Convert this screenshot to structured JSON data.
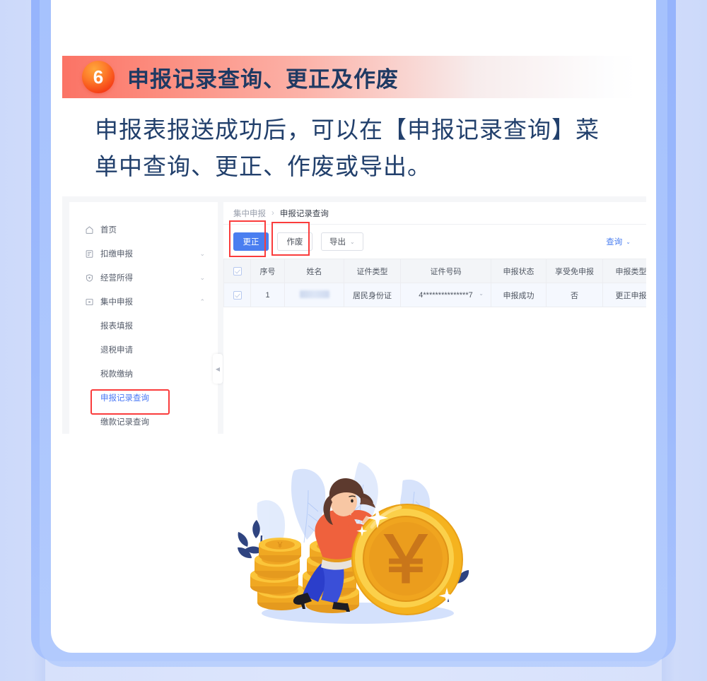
{
  "background": {
    "outer_color": "#dce5fc",
    "band_color": "#ccd9fa",
    "card_blue": "#9cb9fc",
    "page_card": "#ffffff"
  },
  "section": {
    "step_number": "6",
    "title": "申报记录查询、更正及作废",
    "title_color": "#1f3a63",
    "bar_gradient_start": "#fb7365",
    "badge_color": "#f53a14"
  },
  "body": {
    "text": "申报表报送成功后，可以在【申报记录查询】菜单中查询、更正、作废或导出。"
  },
  "app": {
    "sidebar": {
      "items": [
        {
          "label": "首页",
          "icon": "home-icon",
          "expandable": false,
          "chevron": ""
        },
        {
          "label": "扣缴申报",
          "icon": "document-icon",
          "expandable": true,
          "chevron": "⌄"
        },
        {
          "label": "经营所得",
          "icon": "shield-icon",
          "expandable": true,
          "chevron": "⌄"
        },
        {
          "label": "集中申报",
          "icon": "box-icon",
          "expandable": true,
          "chevron": "⌃"
        }
      ],
      "sub_items": [
        {
          "label": "报表填报",
          "active": false
        },
        {
          "label": "退税申请",
          "active": false
        },
        {
          "label": "税款缴纳",
          "active": false
        },
        {
          "label": "申报记录查询",
          "active": true
        },
        {
          "label": "缴款记录查询",
          "active": false
        }
      ],
      "collapse_handle_icon": "collapse-left-icon",
      "highlight_color": "#fa3c3c",
      "active_color": "#4a79f5"
    },
    "breadcrumb": {
      "parent": "集中申报",
      "separator": "›",
      "current": "申报记录查询"
    },
    "toolbar": {
      "correct_label": "更正",
      "void_label": "作废",
      "export_label": "导出",
      "export_chevron": "⌄",
      "query_label": "查询",
      "query_chevron": "⌄",
      "primary_color": "#4a7ef0",
      "highlight_color": "#fa3c3c"
    },
    "table": {
      "headers": [
        "",
        "序号",
        "姓名",
        "证件类型",
        "证件号码",
        "申报状态",
        "享受免申报",
        "申报类型"
      ],
      "rows": [
        {
          "checkbox": true,
          "index": "1",
          "name": "",
          "id_type": "居民身份证",
          "id_number": "4***************7",
          "id_chevron": "⌄",
          "status": "申报成功",
          "exempt": "否",
          "declare_type": "更正申报"
        }
      ]
    }
  },
  "illustration": {
    "name": "woman-pushing-yen-coin",
    "coin_symbol": "￥",
    "coin_color": "#f7b323",
    "coin_inner_color": "#e8901d",
    "shirt_color": "#ef613d",
    "pants_color": "#3a4fd8",
    "hair_color": "#5d3a2e",
    "leaf_color": "#a8c2f6",
    "dark_leaf_color": "#2b3f7a"
  }
}
